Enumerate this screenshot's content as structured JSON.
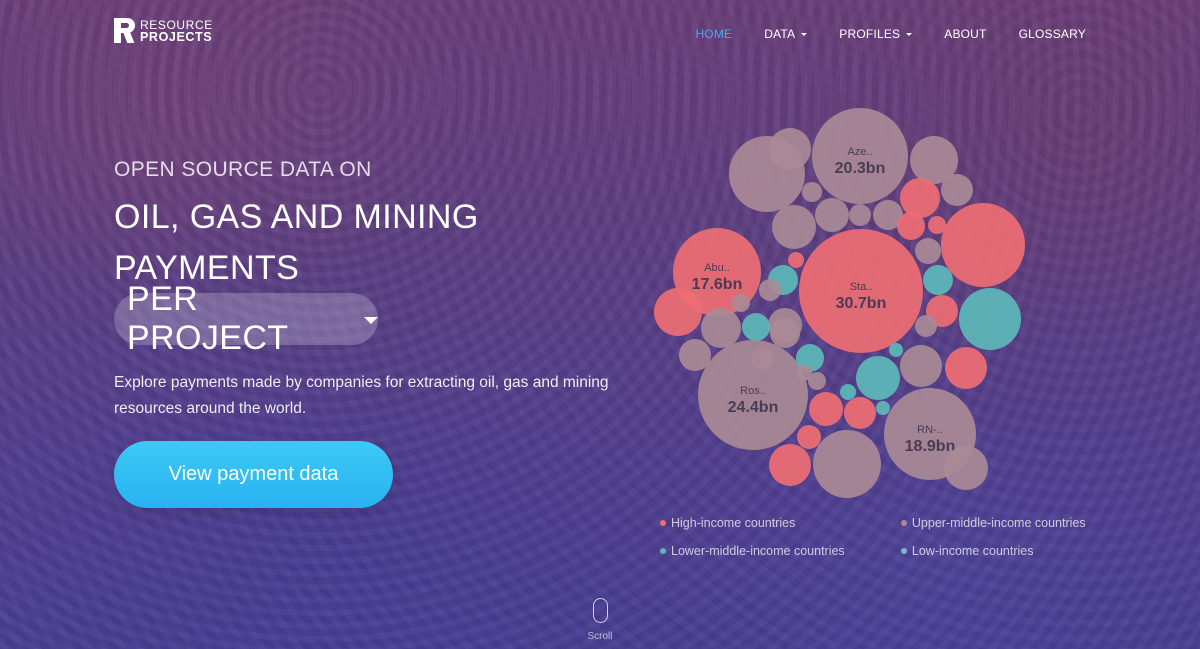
{
  "header": {
    "logo_line1": "RESOURCE",
    "logo_line2": "PROJECTS",
    "nav": [
      {
        "label": "HOME",
        "active": true,
        "dropdown": false
      },
      {
        "label": "DATA",
        "active": false,
        "dropdown": true
      },
      {
        "label": "PROFILES",
        "active": false,
        "dropdown": true
      },
      {
        "label": "ABOUT",
        "active": false,
        "dropdown": false
      },
      {
        "label": "GLOSSARY",
        "active": false,
        "dropdown": false
      }
    ]
  },
  "hero": {
    "kicker": "OPEN SOURCE DATA ON",
    "headline_line1": "OIL, GAS AND MINING",
    "headline_line2": "PAYMENTS",
    "selector_label": "PER PROJECT",
    "description": "Explore payments made by companies for extracting oil, gas and mining resources around the world.",
    "cta_label": "View payment data"
  },
  "colors": {
    "high_income": "#ee6e73",
    "upper_middle_income": "#a98a96",
    "lower_middle_income": "#5cb8b8",
    "low_income": "#7bb9c2",
    "nav_active": "#43a9f0",
    "cta": "#2fbaf3"
  },
  "chart_data": {
    "type": "bubble",
    "labeled_bubbles": [
      {
        "name": "Sta..",
        "value": "30.7bn",
        "group": "high_income"
      },
      {
        "name": "Ros..",
        "value": "24.4bn",
        "group": "upper_middle_income"
      },
      {
        "name": "Aze..",
        "value": "20.3bn",
        "group": "upper_middle_income"
      },
      {
        "name": "RN-..",
        "value": "18.9bn",
        "group": "upper_middle_income"
      },
      {
        "name": "Abu..",
        "value": "17.6bn",
        "group": "high_income"
      }
    ],
    "legend": [
      {
        "label": "High-income countries",
        "group": "high_income"
      },
      {
        "label": "Upper-middle-income countries",
        "group": "upper_middle_income"
      },
      {
        "label": "Lower-middle-income countries",
        "group": "lower_middle_income"
      },
      {
        "label": "Low-income countries",
        "group": "low_income"
      }
    ]
  },
  "scroll_label": "Scroll"
}
